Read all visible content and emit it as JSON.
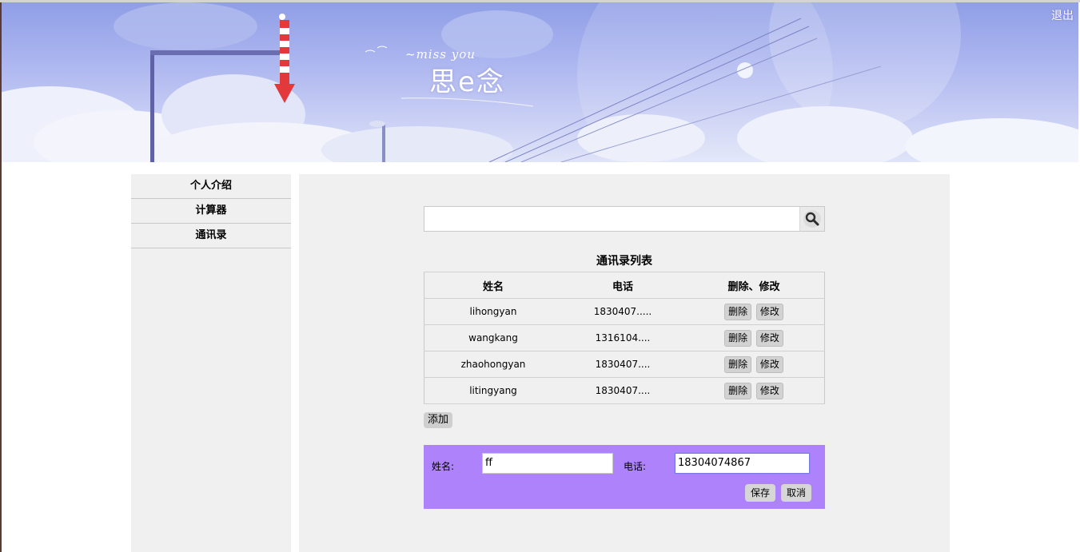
{
  "header": {
    "logout_label": "退出",
    "logo_tagline": "~miss you",
    "logo_text": "思e念"
  },
  "sidebar": {
    "items": [
      {
        "label": "个人介绍"
      },
      {
        "label": "计算器"
      },
      {
        "label": "通讯录"
      }
    ]
  },
  "search": {
    "value": "",
    "icon": "magnifier-icon"
  },
  "contacts": {
    "title": "通讯录列表",
    "columns": [
      "姓名",
      "电话",
      "删除、修改"
    ],
    "delete_label": "删除",
    "edit_label": "修改",
    "rows": [
      {
        "name": "lihongyan",
        "phone": "1830407....."
      },
      {
        "name": "wangkang",
        "phone": "1316104...."
      },
      {
        "name": "zhaohongyan",
        "phone": "1830407...."
      },
      {
        "name": "litingyang",
        "phone": "1830407...."
      }
    ]
  },
  "add_label": "添加",
  "form": {
    "name_label": "姓名:",
    "name_value": "ff",
    "phone_label": "电话:",
    "phone_value": "18304074867",
    "save_label": "保存",
    "cancel_label": "取消",
    "panel_color": "#ad82fb"
  }
}
